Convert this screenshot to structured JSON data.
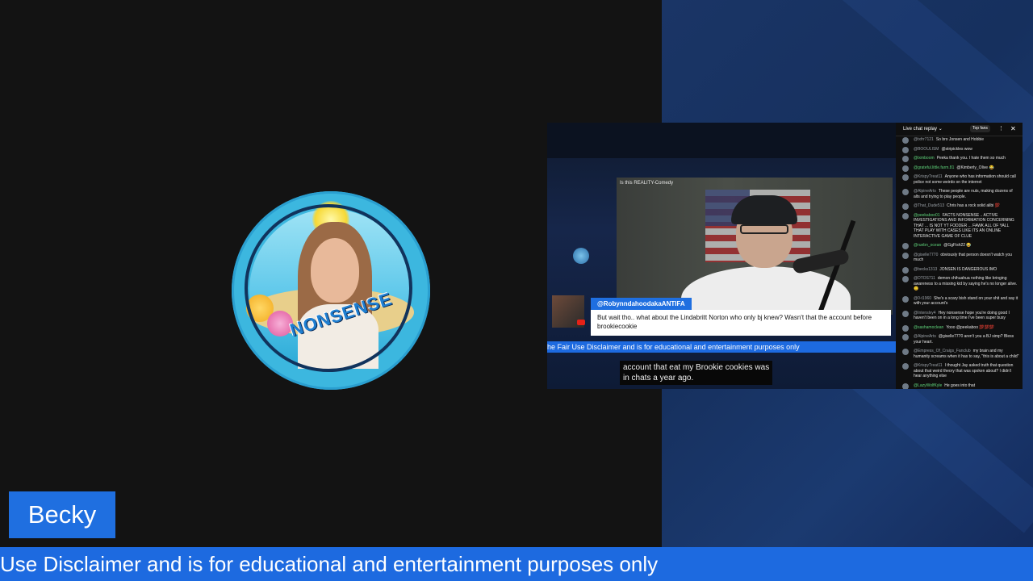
{
  "video": {
    "webcam_title": "Is this REALITY-Comedy",
    "comment": {
      "handle": "@RobynndahoodakaANTIFA",
      "text": "But wait tho.. what about the Lindabritt Norton who only bj knew? Wasn't that the account before brookiecookie"
    },
    "inner_ticker": "he Fair Use Disclaimer and is for educational and entertainment purposes only",
    "caption_line1": "account that eat my Brookie cookies was",
    "caption_line2": "in chats a year ago."
  },
  "avatar": {
    "logo_text": "NONSENSE"
  },
  "chat": {
    "title": "Live chat replay ⌄",
    "top_fans": "Top fans",
    "more_icon": "⋮",
    "close_icon": "✕",
    "messages": [
      {
        "author": "@txfrr7121",
        "text": "So bro Jonsen and Hobbie",
        "green": false
      },
      {
        "author": "@BOOULISM",
        "text": "@stripickles wow",
        "green": false
      },
      {
        "author": "@txmboom",
        "text": "Peeka thank you. I hate them so much",
        "green": true
      },
      {
        "author": "@grateful.little.farm.81",
        "text": "@Kimberly_Olive 😂",
        "green": true
      },
      {
        "author": "@KrispyTreat11",
        "text": "Anyone who has information should call police not some weirdo on the internet",
        "green": false
      },
      {
        "author": "@AlpineArts",
        "text": "These people are nuts, making dozens of alts and trying to play people.",
        "green": false
      },
      {
        "author": "@That_Dude513",
        "text": "Chris has a rock solid alibi 💯",
        "green": false
      },
      {
        "author": "@peekaboo01",
        "text": "FACTS NONSENSE .. ACTIVE INVESTIGATIONS AND INFORMATION CONCERNING THAT ... IS NOT YT FODDER ... FAWK ALL OF YALL THAT PLAY WITH CASES LIKE ITS AN ONLINE INTERACTIVE GAME OF CLUE",
        "green": true
      },
      {
        "author": "@ruebn_ocean",
        "text": "@GgFish22 😂",
        "green": true
      },
      {
        "author": "@giselle7770",
        "text": "obviously that person doesn't watch you much",
        "green": false
      },
      {
        "author": "@becks1313",
        "text": "JONSEN IS DANGEROUS IMO",
        "green": false
      },
      {
        "author": "@DTOS711",
        "text": "demon chihuahua nothing like bringing awareness to a missing kid by saying he's no longer alive. 😐",
        "green": false
      },
      {
        "author": "@0-t1960",
        "text": "She's a scary bish stand on your shit and say it with your account's",
        "green": false
      },
      {
        "author": "@Intenslvy4",
        "text": "Hey nonsense hope you're doing good I haven't been on in a long time I've been super busy",
        "green": false
      },
      {
        "author": "@sashamoclean",
        "text": "Yooo @peekaboo 💯💯💯",
        "green": true
      },
      {
        "author": "@AlpineArts",
        "text": "@giselle7770 aren't you a BJ simp? Bless your heart.",
        "green": false
      },
      {
        "author": "@Empress_Of_Craigs_Fanclub",
        "text": "my brain and my humanity screams when it has to say, \"this is about a child\"",
        "green": false
      },
      {
        "author": "@KrispyTreat11",
        "text": "I thought Jay asked truth that question about that weird theory that was spoken about? I didn't hear anything else",
        "green": false
      },
      {
        "author": "@LazyWolfKyle",
        "text": "He goes into that",
        "green": true
      }
    ]
  },
  "lower_third": {
    "name": "Becky",
    "ticker": "Use Disclaimer and is for educational and entertainment purposes only"
  },
  "colors": {
    "accent_blue": "#1d6ae0",
    "background": "#131313",
    "right_panel": "#16305e"
  }
}
